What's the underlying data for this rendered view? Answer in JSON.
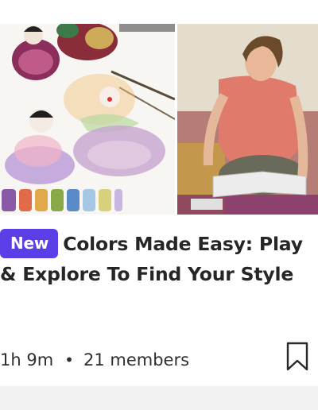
{
  "course": {
    "badge": "New",
    "title": "Colors Made Easy: Play & Explore To Find Your Style",
    "duration": "1h 9m",
    "separator": "•",
    "members": "21 members"
  },
  "icons": {
    "bookmark": "bookmark-icon"
  },
  "colors": {
    "badge_bg": "#5b3ee6",
    "text": "#262626"
  }
}
